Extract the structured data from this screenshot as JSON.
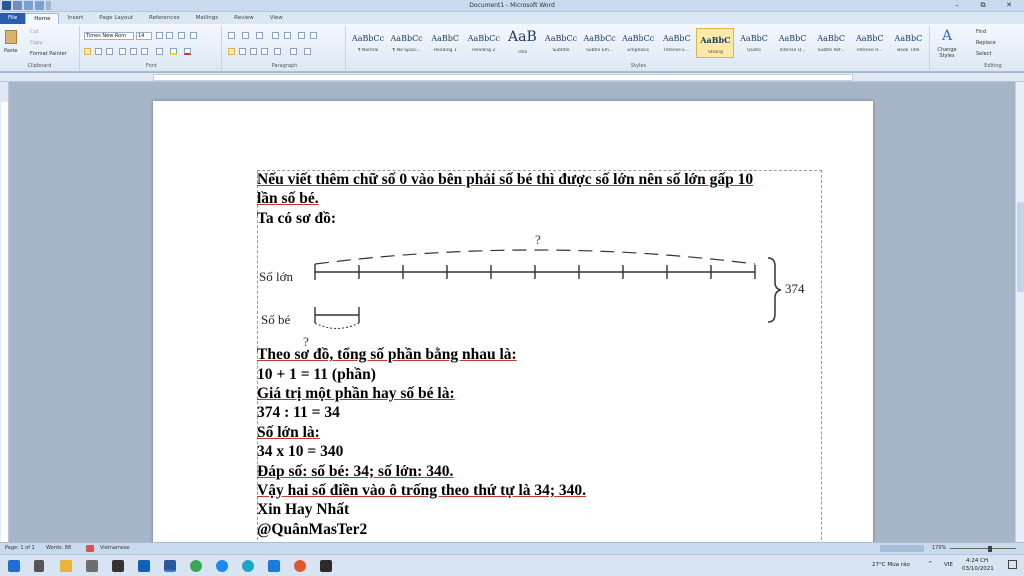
{
  "window": {
    "title": "Document1 - Microsoft Word",
    "controls": [
      "–",
      "⧉",
      "✕"
    ]
  },
  "tabs": [
    "File",
    "Home",
    "Insert",
    "Page Layout",
    "References",
    "Mailings",
    "Review",
    "View"
  ],
  "ribbon": {
    "clipboard": {
      "label": "Clipboard",
      "paste": "Paste",
      "cut": "Cut",
      "copy": "Copy",
      "format_painter": "Format Painter"
    },
    "font": {
      "label": "Font",
      "name": "Times New Rom",
      "size": "14"
    },
    "paragraph": {
      "label": "Paragraph"
    },
    "styles": {
      "label": "Styles",
      "items": [
        {
          "sample": "AaBbCc",
          "name": "¶ Normal"
        },
        {
          "sample": "AaBbCc",
          "name": "¶ No Spaci..."
        },
        {
          "sample": "AaBbC",
          "name": "Heading 1"
        },
        {
          "sample": "AaBbCc",
          "name": "Heading 2"
        },
        {
          "sample": "AaB",
          "name": "Title"
        },
        {
          "sample": "AaBbCc",
          "name": "Subtitle"
        },
        {
          "sample": "AaBbCc",
          "name": "Subtle Em..."
        },
        {
          "sample": "AaBbCc",
          "name": "Emphasis"
        },
        {
          "sample": "AaBbC",
          "name": "Intense E..."
        },
        {
          "sample": "AaBbC",
          "name": "Strong"
        },
        {
          "sample": "AaBbC",
          "name": "Quote"
        },
        {
          "sample": "AaBbC",
          "name": "Intense Q..."
        },
        {
          "sample": "AaBbC",
          "name": "Subtle Ref..."
        },
        {
          "sample": "AaBbC",
          "name": "Intense R..."
        },
        {
          "sample": "AaBbC",
          "name": "Book Title"
        }
      ],
      "change_styles": "Change Styles"
    },
    "editing": {
      "label": "Editing",
      "find": "Find",
      "replace": "Replace",
      "select": "Select"
    }
  },
  "document": {
    "lines": [
      "Nếu viết thêm chữ số 0 vào bên phải số bé thì được số lớn nên số lớn gấp 10",
      "lần số bé.",
      "Ta có sơ đồ:"
    ],
    "diagram": {
      "big_label": "Số lớn",
      "small_label": "Số bé",
      "question_top": "?",
      "question_bottom": "?",
      "total": "374"
    },
    "lines_after": [
      "Theo sơ đồ, tổng số phần bằng nhau là:",
      "10 + 1 = 11 (phần)",
      "Giá trị một phần hay số bé là:",
      "374 : 11 = 34",
      "Số lớn là:",
      "34 x 10 = 340",
      "Đáp số: số bé: 34; số lớn: 340.",
      "Vậy hai số điền vào ô trống theo thứ tự là 34; 340.",
      "Xin Hay Nhất",
      "@QuânMasTer2"
    ]
  },
  "statusbar": {
    "page": "Page: 1 of 1",
    "words": "Words: 88",
    "language": "Vietnamese",
    "zoom": "170%"
  },
  "taskbar": {
    "weather": "27°C  Mưa rào",
    "lang": "VIE",
    "time": "4:24 CH",
    "date": "03/10/2021"
  },
  "colors": {
    "file_tab": "#2a5db0",
    "selected_style": "#fde9a8"
  }
}
